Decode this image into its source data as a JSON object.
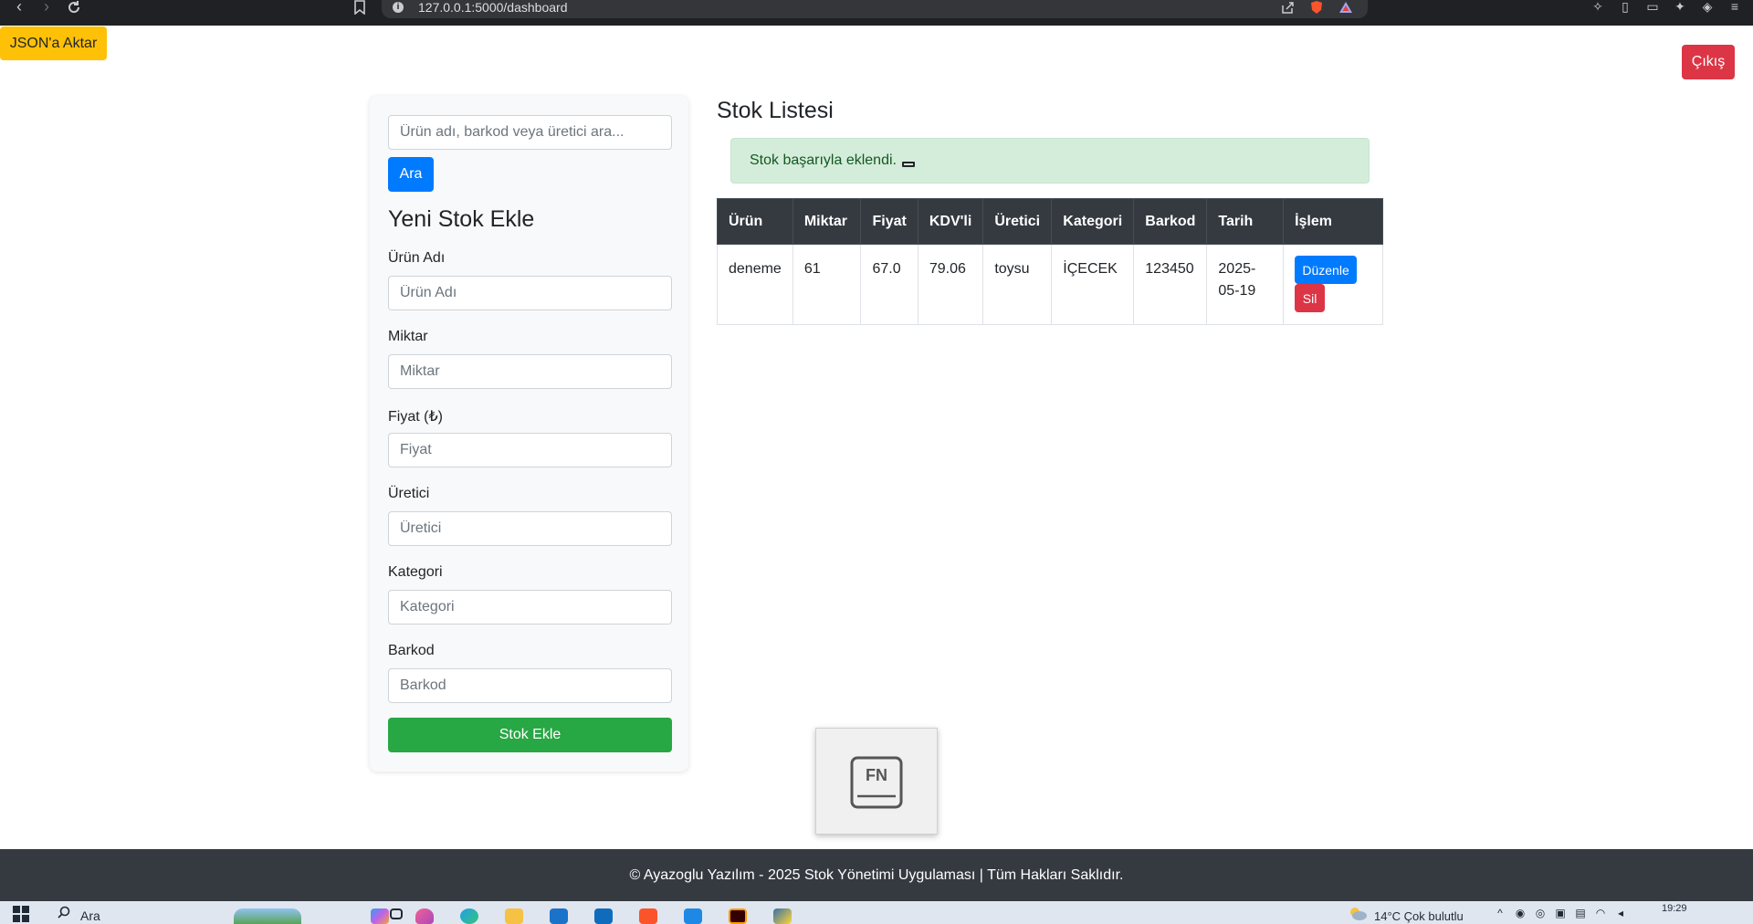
{
  "browser": {
    "url": "127.0.0.1:5000/dashboard"
  },
  "header": {
    "export_label": "JSON'a Aktar",
    "logout_label": "Çıkış"
  },
  "search": {
    "placeholder": "Ürün adı, barkod veya üretici ara...",
    "button_label": "Ara"
  },
  "form": {
    "title": "Yeni Stok Ekle",
    "fields": [
      {
        "label": "Ürün Adı",
        "placeholder": "Ürün Adı"
      },
      {
        "label": "Miktar",
        "placeholder": "Miktar"
      },
      {
        "label": "Fiyat (₺)",
        "placeholder": "Fiyat"
      },
      {
        "label": "Üretici",
        "placeholder": "Üretici"
      },
      {
        "label": "Kategori",
        "placeholder": "Kategori"
      },
      {
        "label": "Barkod",
        "placeholder": "Barkod"
      }
    ],
    "submit_label": "Stok Ekle"
  },
  "stock": {
    "title": "Stok Listesi",
    "alert": "Stok başarıyla eklendi.",
    "columns": [
      "Ürün",
      "Miktar",
      "Fiyat",
      "KDV'li",
      "Üretici",
      "Kategori",
      "Barkod",
      "Tarih",
      "İşlem"
    ],
    "rows": [
      {
        "product": "deneme",
        "quantity": "61",
        "price": "67.0",
        "vat_price": "79.06",
        "producer": "toysu",
        "category": "İÇECEK",
        "barcode": "123450",
        "date": "2025-05-19",
        "edit_label": "Düzenle",
        "delete_label": "Sil"
      }
    ]
  },
  "overlay": {
    "key_label": "FN"
  },
  "footer": {
    "text": "© Ayazoglu Yazılım - 2025 Stok Yönetimi Uygulaması | Tüm Hakları Saklıdır."
  },
  "taskbar": {
    "search_label": "Ara",
    "weather": "14°C  Çok bulutlu",
    "time": "19:29"
  },
  "colors": {
    "warning": "#ffc107",
    "danger": "#dc3545",
    "primary": "#007bff",
    "success": "#28a745",
    "dark": "#343a40",
    "alert_bg": "#d4edda"
  }
}
